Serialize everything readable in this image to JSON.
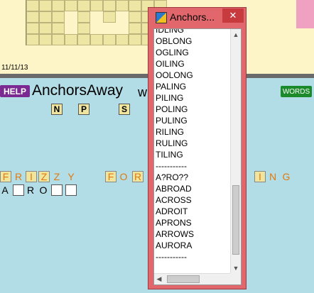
{
  "board": {
    "date": "11/11/13"
  },
  "header": {
    "help_label": "HELP",
    "title": "AnchorsAway",
    "title_tail": "w",
    "words_label": "WORDS"
  },
  "rack": [
    "N",
    "P",
    "S"
  ],
  "row1": {
    "word1": [
      "F",
      "R",
      "I",
      "Z",
      "Z",
      "Y"
    ],
    "word2": [
      "F",
      "O",
      "R"
    ],
    "tail": [
      "I",
      "N",
      "G"
    ]
  },
  "row2": [
    "A",
    "",
    "R",
    "O",
    "",
    ""
  ],
  "window": {
    "title": "Anchors...",
    "close": "✕",
    "words": [
      "IDLING",
      "OBLONG",
      "OGLING",
      "OILING",
      "OOLONG",
      "PALING",
      "PILING",
      "POLING",
      "PULING",
      "RILING",
      "RULING",
      "TILING",
      "-----------",
      "A?RO??",
      "ABROAD",
      "ACROSS",
      "ADROIT",
      "APRONS",
      "ARROWS",
      "AURORA",
      "-----------"
    ],
    "scroll_up": "▲",
    "scroll_down": "▼",
    "scroll_left": "◀",
    "scroll_right": "▶"
  },
  "colors": {
    "accent": "#e07a10",
    "window": "#e2676c",
    "help": "#7a2a90",
    "words": "#1a8a2a"
  }
}
